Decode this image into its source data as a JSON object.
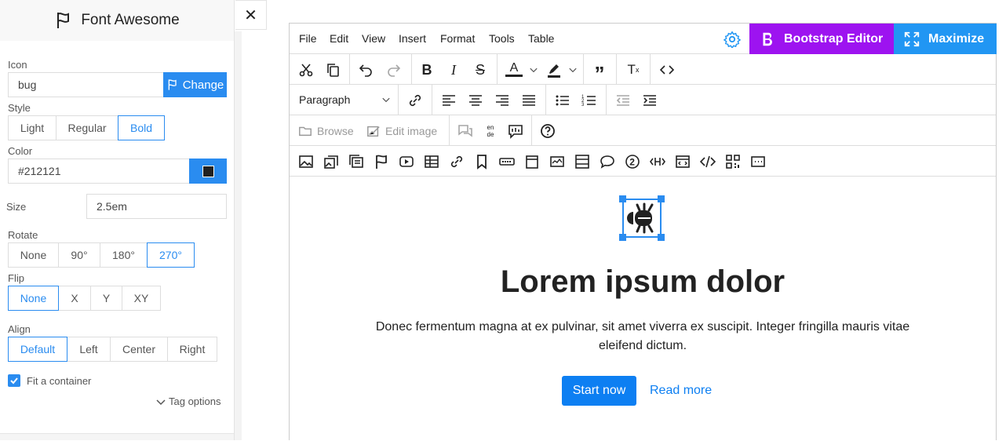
{
  "panel": {
    "title": "Font Awesome",
    "icon_label": "Icon",
    "icon_value": "bug",
    "change_label": "Change",
    "style_label": "Style",
    "style_options": [
      "Light",
      "Regular",
      "Bold"
    ],
    "style_selected": "Bold",
    "color_label": "Color",
    "color_value": "#212121",
    "size_label": "Size",
    "size_value": "2.5em",
    "rotate_label": "Rotate",
    "rotate_options": [
      "None",
      "90°",
      "180°",
      "270°"
    ],
    "rotate_selected": "270°",
    "flip_label": "Flip",
    "flip_options": [
      "None",
      "X",
      "Y",
      "XY"
    ],
    "flip_selected": "None",
    "align_label": "Align",
    "align_options": [
      "Default",
      "Left",
      "Center",
      "Right"
    ],
    "align_selected": "Default",
    "fit_label": "Fit a container",
    "fit_checked": true,
    "tag_options_label": "Tag options",
    "close_glyph": "✕"
  },
  "editor": {
    "menus": [
      "File",
      "Edit",
      "View",
      "Insert",
      "Format",
      "Tools",
      "Table"
    ],
    "bootstrap_label": "Bootstrap Editor",
    "maximize_label": "Maximize",
    "block_format": "Paragraph",
    "browse_label": "Browse",
    "edit_image_label": "Edit image",
    "lang_from": "en",
    "lang_to": "de",
    "accent_color": "#9d13f0",
    "maximize_color": "#2196f3"
  },
  "content": {
    "headline": "Lorem ipsum dolor",
    "paragraph": "Donec fermentum magna at ex pulvinar, sit amet viverra ex suscipit. Integer fringilla mauris vitae eleifend dictum.",
    "primary_button": "Start now",
    "secondary_link": "Read more"
  }
}
